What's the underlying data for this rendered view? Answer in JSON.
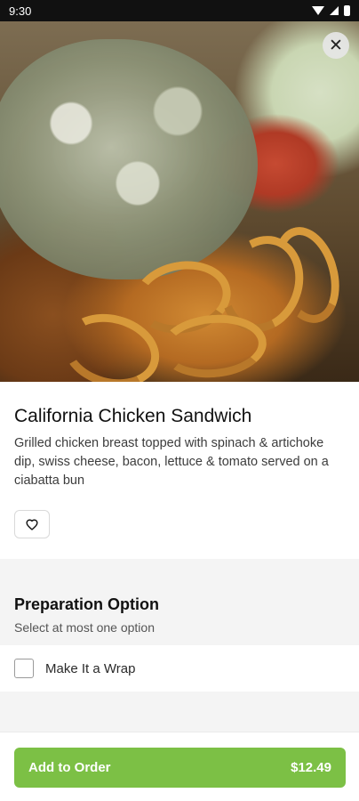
{
  "status_bar": {
    "time": "9:30"
  },
  "item": {
    "title": "California Chicken Sandwich",
    "description": "Grilled chicken breast topped with spinach & artichoke dip, swiss cheese, bacon, lettuce & tomato served on a ciabatta bun"
  },
  "preparation": {
    "title": "Preparation Option",
    "subtitle": "Select at most one option",
    "options": [
      {
        "label": "Make It a Wrap",
        "checked": false
      }
    ]
  },
  "order_button": {
    "label": "Add to Order",
    "price": "$12.49"
  },
  "colors": {
    "accent": "#7cc045"
  },
  "icons": {
    "close": "close-icon",
    "favorite": "heart-icon"
  }
}
